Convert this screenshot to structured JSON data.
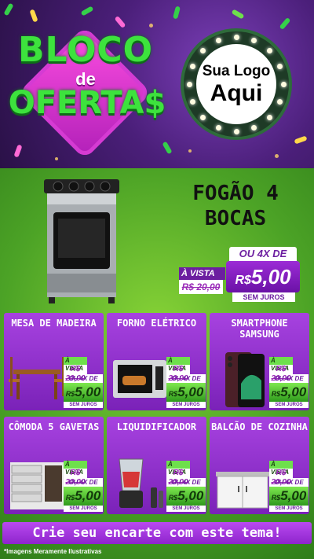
{
  "header": {
    "brand_line1": "BLOCO",
    "brand_line2": "de",
    "brand_line3": "OFERTA$",
    "logo_line1": "Sua Logo",
    "logo_line2": "Aqui"
  },
  "hero": {
    "title": "FOGÃO 4 BOCAS",
    "vista_label": "À VISTA",
    "old_price": "R$ 20,00",
    "installments_label": "OU 4X DE",
    "price_currency": "R$",
    "price_value": "5,00",
    "interest_label": "SEM JUROS"
  },
  "products": [
    {
      "name": "MESA DE MADEIRA"
    },
    {
      "name": "FORNO ELÉTRICO"
    },
    {
      "name": "SMARTPHONE SAMSUNG"
    },
    {
      "name": "CÔMODA 5 GAVETAS"
    },
    {
      "name": "LIQUIDIFICADOR"
    },
    {
      "name": "BALCÃO DE COZINHA"
    }
  ],
  "card_tag": {
    "vista_label": "À VISTA",
    "old_price": "R$ 20,00",
    "installments_label": "OU 4X DE",
    "price_currency": "R$",
    "price_value": "5,00",
    "interest_label": "SEM JUROS"
  },
  "cta": {
    "label": "Crie seu encarte com este tema!"
  },
  "disclaimer": "*Imagens Meramente Ilustrativas",
  "colors": {
    "purple": "#8e24cc",
    "green": "#4ca326",
    "accent_green": "#3de23d"
  }
}
